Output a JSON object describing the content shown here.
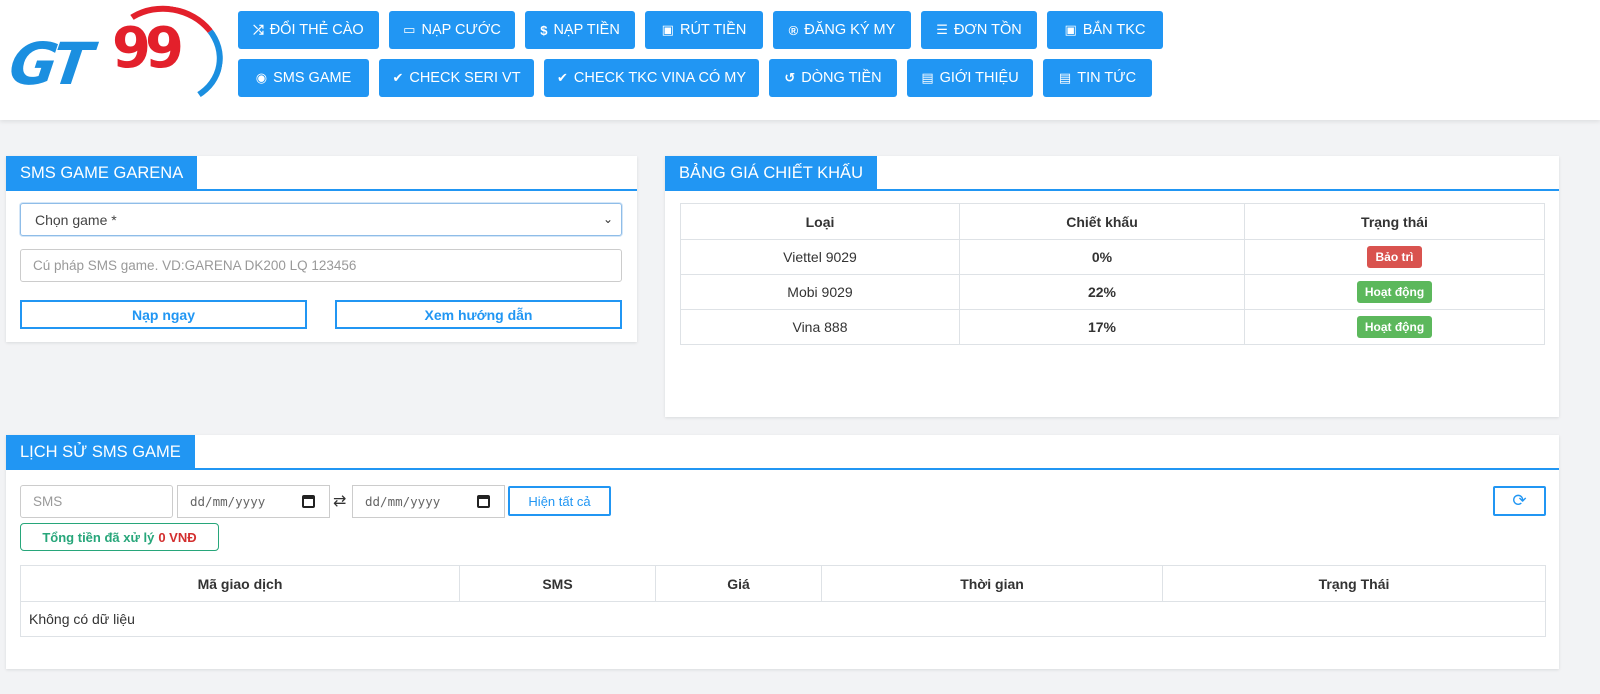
{
  "brand": {
    "logo_text_left": "GT",
    "logo_text_right": "99"
  },
  "nav": {
    "row1": [
      {
        "icon": "shuffle-icon",
        "glyph": "⤮",
        "label": "ĐỔI THẺ CÀO"
      },
      {
        "icon": "card-icon",
        "glyph": "▭",
        "label": "NẠP CƯỚC"
      },
      {
        "icon": "dollar-icon",
        "glyph": "$",
        "label": "NẠP TIỀN"
      },
      {
        "icon": "money-icon",
        "glyph": "▣",
        "label": "RÚT TIỀN"
      },
      {
        "icon": "registered-icon",
        "glyph": "®",
        "label": "ĐĂNG KÝ MY"
      },
      {
        "icon": "list-icon",
        "glyph": "☰",
        "label": "ĐƠN TỒN"
      },
      {
        "icon": "money-icon",
        "glyph": "▣",
        "label": "BẮN TKC"
      }
    ],
    "row2": [
      {
        "icon": "gamepad-icon",
        "glyph": "◉",
        "label": "SMS GAME"
      },
      {
        "icon": "check-icon",
        "glyph": "✔",
        "label": "CHECK SERI VT"
      },
      {
        "icon": "check-icon",
        "glyph": "✔",
        "label": "CHECK TKC VINA CÓ MY"
      },
      {
        "icon": "history-icon",
        "glyph": "↺",
        "label": "DÒNG TIỀN"
      },
      {
        "icon": "newspaper-icon",
        "glyph": "▤",
        "label": "GIỚI THIỆU"
      },
      {
        "icon": "newspaper-icon",
        "glyph": "▤",
        "label": "TIN TỨC"
      }
    ]
  },
  "sms_game": {
    "title": "SMS GAME GARENA",
    "select_value": "Chọn game *",
    "syntax_placeholder": "Cú pháp SMS game. VD:GARENA DK200 LQ 123456",
    "submit_label": "Nạp ngay",
    "guide_label": "Xem hướng dẫn"
  },
  "discount": {
    "title": "BẢNG GIÁ CHIẾT KHẤU",
    "columns": [
      "Loại",
      "Chiết khấu",
      "Trạng thái"
    ],
    "rows": [
      {
        "type": "Viettel 9029",
        "discount": "0%",
        "status": "Bảo trì",
        "status_color": "#d9534f"
      },
      {
        "type": "Mobi 9029",
        "discount": "22%",
        "status": "Hoạt động",
        "status_color": "#5cb85c"
      },
      {
        "type": "Vina 888",
        "discount": "17%",
        "status": "Hoạt động",
        "status_color": "#5cb85c"
      }
    ]
  },
  "history": {
    "title": "LỊCH SỬ SMS GAME",
    "sms_placeholder": "SMS",
    "date_from": "dd/mm/yyyy",
    "date_to": "dd/mm/yyyy",
    "swap_glyph": "⇄",
    "show_all_label": "Hiện tất cả",
    "refresh_glyph": "⟳",
    "total_label": "Tổng tiền đã xử lý",
    "total_value": "0 VNĐ",
    "columns": [
      "Mã giao dịch",
      "SMS",
      "Giá",
      "Thời gian",
      "Trạng Thái"
    ],
    "empty_text": "Không có dữ liệu"
  },
  "colors": {
    "primary": "#2196f3",
    "success": "#5cb85c",
    "danger": "#d9534f",
    "total_green": "#27a67a"
  }
}
